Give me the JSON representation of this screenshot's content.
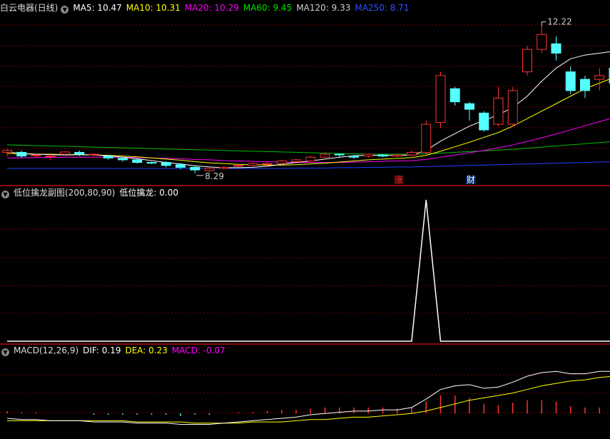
{
  "main_header": {
    "stock_name": "白云电器(日线)",
    "ma": [
      {
        "label": "MA5: 10.47",
        "color": "#ffffff"
      },
      {
        "label": "MA10: 10.31",
        "color": "#ffff00"
      },
      {
        "label": "MA20: 10.29",
        "color": "#ff00ff"
      },
      {
        "label": "MA60: 9.45",
        "color": "#00e000"
      },
      {
        "label": "MA120: 9.33",
        "color": "#d0d0d0"
      },
      {
        "label": "MA250: 8.71",
        "color": "#3050ff"
      }
    ]
  },
  "price_labels": {
    "high": "12.22",
    "low": "8.29"
  },
  "tags": {
    "zhang": "涨",
    "cai": "财"
  },
  "sub1_header": {
    "name": "低位擒龙副图(200,80,90)",
    "value": "低位擒龙: 0.00"
  },
  "macd_header": {
    "name": "MACD(12,26,9)",
    "dif": "DIF: 0.19",
    "dea": "DEA: 0.23",
    "macd": "MACD: -0.07"
  },
  "colors": {
    "up": "#ff3232",
    "down": "#54ffff",
    "grid": "#7a0000",
    "dif": "#ffffff",
    "dea": "#ffff00",
    "macd_label": "#ff00ff"
  },
  "chart_data": {
    "type": "candlestick",
    "candles": [
      [
        8.85,
        8.9,
        8.75,
        8.95
      ],
      [
        8.85,
        8.75,
        8.7,
        8.9
      ],
      [
        8.76,
        8.78,
        8.72,
        8.8
      ],
      [
        8.73,
        8.75,
        8.65,
        8.8
      ],
      [
        8.8,
        8.86,
        8.78,
        8.88
      ],
      [
        8.85,
        8.8,
        8.75,
        8.9
      ],
      [
        8.79,
        8.8,
        8.75,
        8.82
      ],
      [
        8.75,
        8.7,
        8.65,
        8.78
      ],
      [
        8.69,
        8.65,
        8.6,
        8.72
      ],
      [
        8.65,
        8.58,
        8.55,
        8.68
      ],
      [
        8.58,
        8.56,
        8.54,
        8.6
      ],
      [
        8.58,
        8.5,
        8.45,
        8.62
      ],
      [
        8.52,
        8.45,
        8.4,
        8.55
      ],
      [
        8.45,
        8.38,
        8.29,
        8.5
      ],
      [
        8.36,
        8.42,
        8.33,
        8.45
      ],
      [
        8.42,
        8.45,
        8.4,
        8.48
      ],
      [
        8.48,
        8.5,
        8.45,
        8.55
      ],
      [
        8.5,
        8.55,
        8.47,
        8.58
      ],
      [
        8.55,
        8.55,
        8.52,
        8.58
      ],
      [
        8.55,
        8.62,
        8.5,
        8.65
      ],
      [
        8.6,
        8.65,
        8.58,
        8.68
      ],
      [
        8.62,
        8.72,
        8.6,
        8.75
      ],
      [
        8.72,
        8.8,
        8.7,
        8.85
      ],
      [
        8.8,
        8.78,
        8.72,
        8.82
      ],
      [
        8.75,
        8.72,
        8.68,
        8.78
      ],
      [
        8.75,
        8.8,
        8.7,
        8.82
      ],
      [
        8.78,
        8.75,
        8.72,
        8.8
      ],
      [
        8.75,
        8.78,
        8.72,
        8.82
      ],
      [
        8.78,
        8.85,
        8.75,
        8.9
      ],
      [
        8.85,
        9.6,
        8.8,
        9.7
      ],
      [
        9.65,
        10.9,
        9.5,
        11.0
      ],
      [
        10.55,
        10.2,
        10.1,
        10.6
      ],
      [
        10.15,
        10.0,
        9.7,
        10.2
      ],
      [
        9.9,
        9.45,
        9.4,
        9.95
      ],
      [
        9.6,
        10.3,
        9.55,
        10.6
      ],
      [
        9.6,
        10.5,
        9.55,
        10.6
      ],
      [
        11.0,
        11.6,
        10.9,
        11.7
      ],
      [
        11.6,
        12.0,
        11.5,
        12.22
      ],
      [
        11.75,
        11.5,
        11.3,
        11.95
      ],
      [
        11.0,
        10.5,
        10.4,
        11.15
      ],
      [
        10.8,
        10.5,
        10.3,
        10.9
      ],
      [
        10.8,
        10.9,
        10.5,
        11.1
      ],
      [
        11.1,
        10.7,
        10.5,
        11.2
      ],
      [
        10.7,
        10.78,
        10.6,
        11.2
      ],
      [
        10.75,
        10.6,
        10.5,
        10.8
      ],
      [
        10.6,
        10.3,
        10.2,
        10.7
      ],
      [
        10.3,
        10.3,
        10.2,
        10.35
      ],
      [
        10.2,
        10.4,
        10.1,
        10.5
      ],
      [
        10.5,
        10.6,
        10.45,
        10.65
      ],
      [
        10.62,
        10.7,
        10.55,
        10.72
      ],
      [
        10.68,
        10.62,
        10.6,
        10.75
      ],
      [
        10.55,
        10.45,
        10.4,
        10.6
      ],
      [
        10.4,
        10.4,
        10.35,
        10.45
      ],
      [
        10.3,
        10.35,
        10.25,
        10.4
      ]
    ],
    "ma5": [
      8.86,
      8.82,
      8.8,
      8.79,
      8.78,
      8.79,
      8.78,
      8.76,
      8.72,
      8.68,
      8.63,
      8.58,
      8.54,
      8.49,
      8.46,
      8.44,
      8.44,
      8.45,
      8.48,
      8.53,
      8.58,
      8.62,
      8.67,
      8.72,
      8.76,
      8.77,
      8.77,
      8.77,
      8.78,
      8.9,
      9.15,
      9.35,
      9.55,
      9.7,
      9.85,
      10.05,
      10.35,
      10.75,
      11.1,
      11.35,
      11.45,
      11.5,
      11.55,
      11.5,
      11.35,
      11.15,
      10.95,
      10.8,
      10.75,
      10.72,
      10.65,
      10.6,
      10.55,
      10.5
    ],
    "ma10": [
      8.82,
      8.81,
      8.8,
      8.8,
      8.79,
      8.79,
      8.78,
      8.77,
      8.75,
      8.73,
      8.7,
      8.67,
      8.64,
      8.6,
      8.57,
      8.55,
      8.53,
      8.52,
      8.51,
      8.51,
      8.52,
      8.54,
      8.56,
      8.59,
      8.62,
      8.65,
      8.67,
      8.69,
      8.71,
      8.77,
      8.88,
      9.0,
      9.12,
      9.25,
      9.38,
      9.55,
      9.75,
      9.95,
      10.15,
      10.35,
      10.55,
      10.7,
      10.85,
      10.95,
      11.0,
      11.0,
      10.95,
      10.88,
      10.82,
      10.78,
      10.72,
      10.66,
      10.6,
      10.55
    ],
    "ma20": [
      8.7,
      8.7,
      8.71,
      8.71,
      8.72,
      8.72,
      8.72,
      8.72,
      8.72,
      8.71,
      8.7,
      8.69,
      8.68,
      8.66,
      8.65,
      8.63,
      8.62,
      8.61,
      8.6,
      8.59,
      8.58,
      8.58,
      8.58,
      8.58,
      8.59,
      8.6,
      8.61,
      8.62,
      8.63,
      8.66,
      8.72,
      8.78,
      8.84,
      8.9,
      8.97,
      9.05,
      9.14,
      9.24,
      9.34,
      9.45,
      9.56,
      9.67,
      9.78,
      9.88,
      9.97,
      10.05,
      10.12,
      10.18,
      10.23,
      10.27,
      10.3,
      10.32,
      10.34,
      10.35
    ],
    "ma60": [
      9.05,
      9.04,
      9.03,
      9.02,
      9.01,
      9.0,
      8.99,
      8.98,
      8.97,
      8.96,
      8.95,
      8.94,
      8.93,
      8.92,
      8.91,
      8.9,
      8.89,
      8.88,
      8.87,
      8.86,
      8.85,
      8.84,
      8.83,
      8.82,
      8.81,
      8.8,
      8.8,
      8.8,
      8.8,
      8.81,
      8.83,
      8.85,
      8.87,
      8.89,
      8.91,
      8.93,
      8.96,
      8.99,
      9.02,
      9.05,
      9.08,
      9.11,
      9.14,
      9.17,
      9.2,
      9.23,
      9.26,
      9.29,
      9.32,
      9.35,
      9.38,
      9.41,
      9.43,
      9.45
    ],
    "ma250": [
      8.42,
      8.42,
      8.42,
      8.42,
      8.42,
      8.42,
      8.42,
      8.42,
      8.42,
      8.42,
      8.42,
      8.42,
      8.42,
      8.42,
      8.42,
      8.42,
      8.42,
      8.42,
      8.42,
      8.42,
      8.43,
      8.43,
      8.43,
      8.44,
      8.44,
      8.45,
      8.45,
      8.46,
      8.46,
      8.47,
      8.48,
      8.49,
      8.5,
      8.51,
      8.52,
      8.53,
      8.54,
      8.55,
      8.56,
      8.57,
      8.58,
      8.59,
      8.6,
      8.61,
      8.62,
      8.63,
      8.64,
      8.65,
      8.66,
      8.67,
      8.68,
      8.69,
      8.7,
      8.71
    ],
    "sub1": {
      "ylim": [
        0,
        100
      ],
      "values": [
        0,
        0,
        0,
        0,
        0,
        0,
        0,
        0,
        0,
        0,
        0,
        0,
        0,
        0,
        0,
        0,
        0,
        0,
        0,
        0,
        0,
        0,
        0,
        0,
        0,
        0,
        0,
        0,
        0,
        0,
        0,
        0,
        0,
        0,
        0,
        0,
        0,
        0,
        0,
        0,
        0,
        0,
        0,
        0,
        0,
        0,
        0,
        0,
        0,
        0,
        0,
        0,
        0,
        0
      ],
      "peak_index": 29,
      "peak_value": 100
    },
    "macd": {
      "ylim": [
        -0.2,
        0.5
      ],
      "dif": [
        -0.04,
        -0.05,
        -0.05,
        -0.06,
        -0.06,
        -0.06,
        -0.07,
        -0.07,
        -0.07,
        -0.08,
        -0.08,
        -0.08,
        -0.09,
        -0.09,
        -0.09,
        -0.08,
        -0.07,
        -0.06,
        -0.05,
        -0.04,
        -0.03,
        -0.01,
        0.0,
        0.01,
        0.02,
        0.02,
        0.03,
        0.03,
        0.05,
        0.12,
        0.2,
        0.23,
        0.24,
        0.21,
        0.22,
        0.26,
        0.31,
        0.34,
        0.35,
        0.33,
        0.33,
        0.35,
        0.35,
        0.34,
        0.31,
        0.27,
        0.24,
        0.23,
        0.22,
        0.2,
        0.18,
        0.17,
        0.16,
        0.15
      ],
      "dea": [
        -0.06,
        -0.06,
        -0.06,
        -0.06,
        -0.06,
        -0.06,
        -0.06,
        -0.06,
        -0.06,
        -0.07,
        -0.07,
        -0.07,
        -0.07,
        -0.08,
        -0.08,
        -0.08,
        -0.08,
        -0.07,
        -0.07,
        -0.07,
        -0.06,
        -0.05,
        -0.05,
        -0.04,
        -0.03,
        -0.03,
        -0.02,
        -0.01,
        0.0,
        0.02,
        0.05,
        0.08,
        0.11,
        0.13,
        0.15,
        0.17,
        0.2,
        0.23,
        0.25,
        0.27,
        0.28,
        0.3,
        0.31,
        0.32,
        0.32,
        0.31,
        0.3,
        0.29,
        0.28,
        0.27,
        0.26,
        0.25,
        0.24,
        0.23
      ],
      "hist": [
        0.02,
        0.01,
        0.01,
        0.0,
        0.0,
        0.0,
        -0.01,
        -0.01,
        -0.01,
        -0.01,
        -0.01,
        -0.01,
        -0.02,
        -0.01,
        -0.01,
        0.0,
        0.01,
        0.01,
        0.02,
        0.03,
        0.03,
        0.04,
        0.05,
        0.05,
        0.05,
        0.05,
        0.05,
        0.04,
        0.05,
        0.1,
        0.15,
        0.15,
        0.13,
        0.08,
        0.07,
        0.09,
        0.11,
        0.11,
        0.1,
        0.06,
        0.05,
        0.05,
        0.04,
        0.02,
        -0.01,
        -0.04,
        -0.06,
        -0.06,
        -0.06,
        -0.07,
        -0.08,
        -0.08,
        -0.08,
        -0.07
      ]
    }
  }
}
